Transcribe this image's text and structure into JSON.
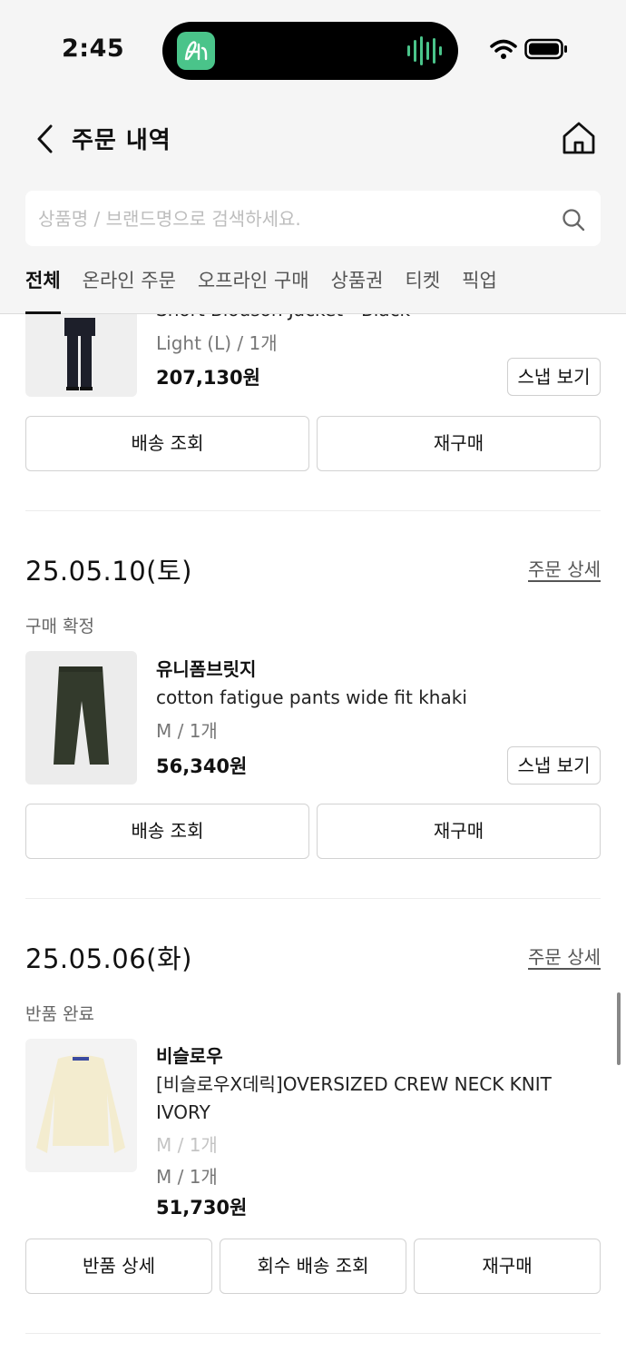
{
  "status_bar": {
    "time": "2:45"
  },
  "header": {
    "title": "주문 내역"
  },
  "search": {
    "placeholder": "상품명 / 브랜드명으로 검색하세요."
  },
  "tabs": [
    {
      "label": "전체",
      "active": true
    },
    {
      "label": "온라인 주문"
    },
    {
      "label": "오프라인 구매"
    },
    {
      "label": "상품권"
    },
    {
      "label": "티켓"
    },
    {
      "label": "픽업"
    }
  ],
  "order0": {
    "product_name": "Short Blouson Jacket - Black",
    "option": "Light (L) / 1개",
    "price": "207,130원",
    "snap_label": "스냅 보기",
    "buttons": {
      "delivery": "배송 조회",
      "rebuy": "재구매"
    }
  },
  "order1": {
    "date": "25.05.10(토)",
    "detail_link": "주문 상세",
    "status": "구매 확정",
    "brand": "유니폼브릿지",
    "product_name": "cotton fatigue pants wide fit khaki",
    "option": "M / 1개",
    "price": "56,340원",
    "snap_label": "스냅 보기",
    "buttons": {
      "delivery": "배송 조회",
      "rebuy": "재구매"
    }
  },
  "order2": {
    "date": "25.05.06(화)",
    "detail_link": "주문 상세",
    "status": "반품 완료",
    "brand": "비슬로우",
    "product_name": "[비슬로우X데릭]OVERSIZED CREW NECK KNIT IVORY",
    "option_original": "M / 1개",
    "option": "M / 1개",
    "price": "51,730원",
    "buttons": {
      "return_detail": "반품 상세",
      "pickup_delivery": "회수 배송 조회",
      "rebuy": "재구매"
    }
  },
  "colors": {
    "accent": "#4ac48a",
    "background": "#f5f5f5",
    "text": "#111111"
  }
}
